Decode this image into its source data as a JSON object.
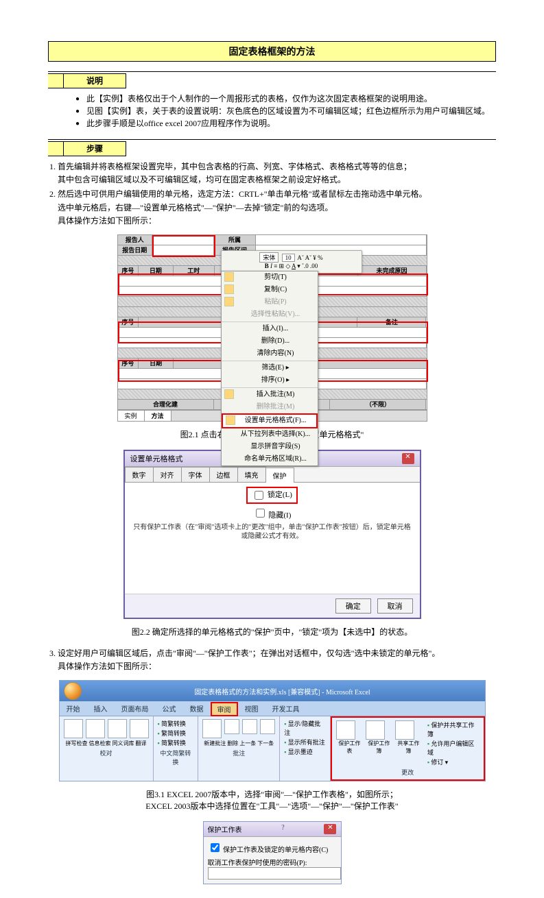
{
  "title": "固定表格框架的方法",
  "section_desc_label": "说明",
  "desc_bullets": [
    "此【实例】表格仅出于个人制作的一个周报形式的表格，仅作为这次固定表格框架的说明用途。",
    "见图【实例】表，关于表的设置说明：灰色底色的区域设置为不可编辑区域；红色边框所示为用户可编辑区域。",
    "此步骤手顺是以office excel 2007应用程序作为说明。"
  ],
  "section_steps_label": "步骤",
  "steps": {
    "s1_l1": "首先编辑并将表格框架设置完毕，其中包含表格的行高、列宽、字体格式、表格格式等等的信息；",
    "s1_l2": "其中包含可编辑区域以及不可编辑区域，均可在固定表格框架之前设定好格式。",
    "s2_l1": "然后选中可供用户编辑使用的单元格，选定方法：CRTL+\"单击单元格\"或者鼠标左击拖动选中单元格。",
    "s2_l2": "选中单元格后，右键—\"设置单元格格式\"—\"保护\"—去掉\"锁定\"前的勾选项。",
    "s2_l3": "具体操作方法如下图所示：",
    "s3_l1": "设定好用户可编辑区域后，点击\"审阅\"—\"保护工作表\"；在弹出对话框中，仅勾选\"选中未锁定的单元格\"。",
    "s3_l2": "具体操作方法如下图所示："
  },
  "fig1": {
    "headers": {
      "reporter": "报告人",
      "belong": "所属",
      "report_date": "报告日期",
      "report_interval": "报告区间",
      "seq": "序号",
      "date": "日期",
      "worktime": "工时",
      "incomplete_reason": "未完成原因",
      "remark": "备注",
      "rationalize": "合理化建",
      "unlimited": "（不限）"
    },
    "mini_toolbar": {
      "font": "宋体",
      "size": "10"
    },
    "menu": {
      "cut": "剪切(T)",
      "copy": "复制(C)",
      "paste": "粘贴(P)",
      "paste_special": "选择性粘贴(V)...",
      "insert": "插入(I)...",
      "delete": "删除(D)...",
      "clear": "清除内容(N)",
      "filter": "筛选(E)",
      "sort": "排序(O)",
      "insert_comment": "插入批注(M)",
      "delete_comment": "删除批注(M)",
      "format_cells": "设置单元格格式(F)...",
      "pick_list": "从下拉列表中选择(K)...",
      "phonetic": "显示拼音字段(S)",
      "name_range": "命名单元格区域(R)..."
    },
    "tabs": {
      "t1": "实例",
      "t2": "方法"
    },
    "caption": "图2.1 点击右键，选择红色标示处\"设置单元格格式\""
  },
  "fig2": {
    "dlg_title": "设置单元格格式",
    "tabs": {
      "number": "数字",
      "align": "对齐",
      "font": "字体",
      "border": "边框",
      "fill": "填充",
      "protect": "保护"
    },
    "lock_label": "锁定(L)",
    "hidden_label": "隐藏(I)",
    "note": "只有保护工作表（在\"审阅\"选项卡上的\"更改\"组中，单击\"保护工作表\"按钮）后，锁定单元格或隐藏公式才有效。",
    "ok": "确定",
    "cancel": "取消",
    "caption": "图2.2 确定所选择的单元格格式的\"保护\"页中，\"锁定\"项为【未选中】的状态。"
  },
  "fig3": {
    "window_title": "固定表格格式的方法和实例.xls  [兼容模式] - Microsoft Excel",
    "tabs": {
      "home": "开始",
      "insert": "插入",
      "layout": "页面布局",
      "formula": "公式",
      "data": "数据",
      "review": "审阅",
      "view": "视图",
      "dev": "开发工具"
    },
    "groups": {
      "proof_items": {
        "a": "拼写检查",
        "b": "信息检索",
        "c": "同义词库",
        "d": "翻译",
        "label": "校对"
      },
      "cn": {
        "a": "简繁转换",
        "b": "繁简转换",
        "c": "简繁转换",
        "label": "中文简繁转换"
      },
      "comment": {
        "a": "新建批注",
        "b": "删除",
        "c": "上一条",
        "d": "下一条",
        "label": "批注"
      },
      "show": {
        "a": "显示/隐藏批注",
        "b": "显示所有批注",
        "c": "显示墨迹"
      },
      "changes": {
        "a": "保护工作表",
        "b": "保护工作簿",
        "c": "共享工作簿",
        "d": "保护并共享工作簿",
        "e": "允许用户编辑区域",
        "f": "修订 ▾",
        "label": "更改"
      }
    },
    "caption_l1": "图3.1 EXCEL 2007版本中，选择\"审阅\"—\"保护工作表格\"，如图所示；",
    "caption_l2": "EXCEL 2003版本中选择位置在\"工具\"—\"选项\"—\"保护\"—\"保护工作表\""
  },
  "fig4": {
    "title": "保护工作表",
    "chk": "保护工作表及锁定的单元格内容(C)",
    "pwd_label": "取消工作表保护时使用的密码(P):"
  }
}
